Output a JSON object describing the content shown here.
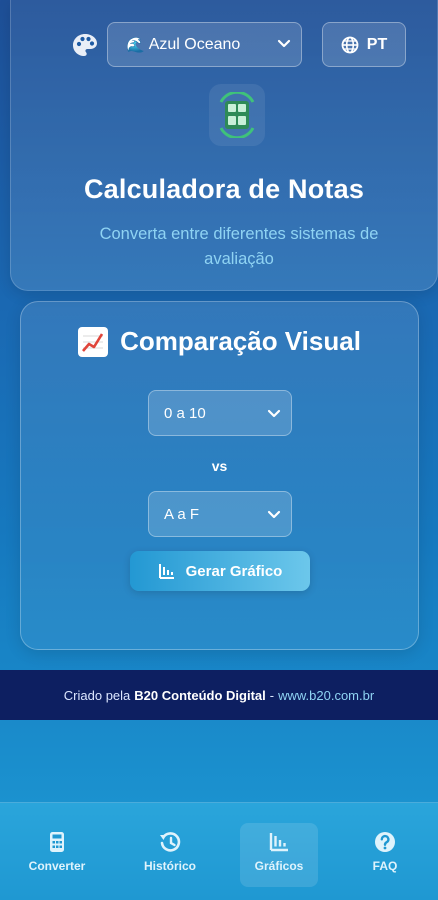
{
  "header": {
    "theme_select_value": "Azul Oceano",
    "theme_emoji": "🌊",
    "language_label": "PT",
    "title": "Calculadora de Notas",
    "subtitle": "Converta entre diferentes sistemas de avaliação"
  },
  "compare": {
    "title": "Comparação Visual",
    "scale_a_value": "0 a 10",
    "vs_label": "vs",
    "scale_b_value": "A a F",
    "generate_button_label": "Gerar Gráfico"
  },
  "footer": {
    "prefix": "Criado pela",
    "brand": "B20 Conteúdo Digital",
    "separator": "-",
    "link": "www.b20.com.br"
  },
  "nav": {
    "items": [
      {
        "label": "Converter",
        "icon": "calculator-icon"
      },
      {
        "label": "Histórico",
        "icon": "history-icon"
      },
      {
        "label": "Gráficos",
        "icon": "chart-icon",
        "active": true
      },
      {
        "label": "FAQ",
        "icon": "help-icon"
      }
    ]
  },
  "colors": {
    "accent": "#2398d3",
    "footer_bg": "#0d1f61",
    "subtitle": "#8fd3f3"
  }
}
